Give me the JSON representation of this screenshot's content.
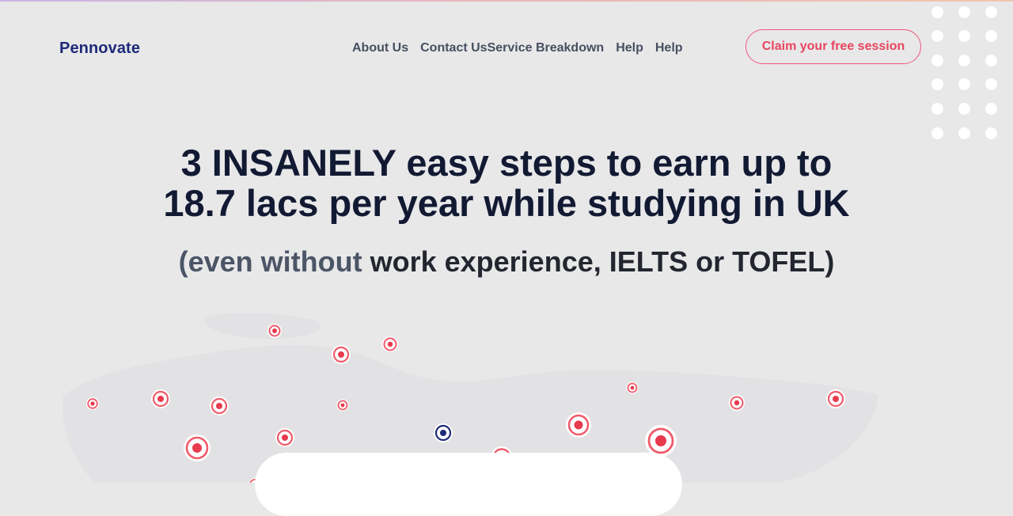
{
  "header": {
    "logo": "Pennovate",
    "nav": [
      {
        "label": "About Us",
        "name": "nav-about-us"
      },
      {
        "label": "Contact Us",
        "name": "nav-contact-us"
      },
      {
        "label": "Service Breakdown",
        "name": "nav-service-breakdown"
      },
      {
        "label": "Help",
        "name": "nav-help"
      },
      {
        "label": "Help",
        "name": "nav-help-2"
      }
    ],
    "cta_label": "Claim your free session"
  },
  "hero": {
    "headline_line1": "3 INSANELY easy steps to earn up to",
    "headline_line2": "18.7 lacs per year while studying in UK",
    "sub_muted": "(even without",
    "sub_strong": "work experience, IELTS or TOFEL)"
  },
  "colors": {
    "background": "#e8e8e9",
    "brand": "#1e2a78",
    "accent": "#e8455f",
    "headline": "#121a33"
  }
}
